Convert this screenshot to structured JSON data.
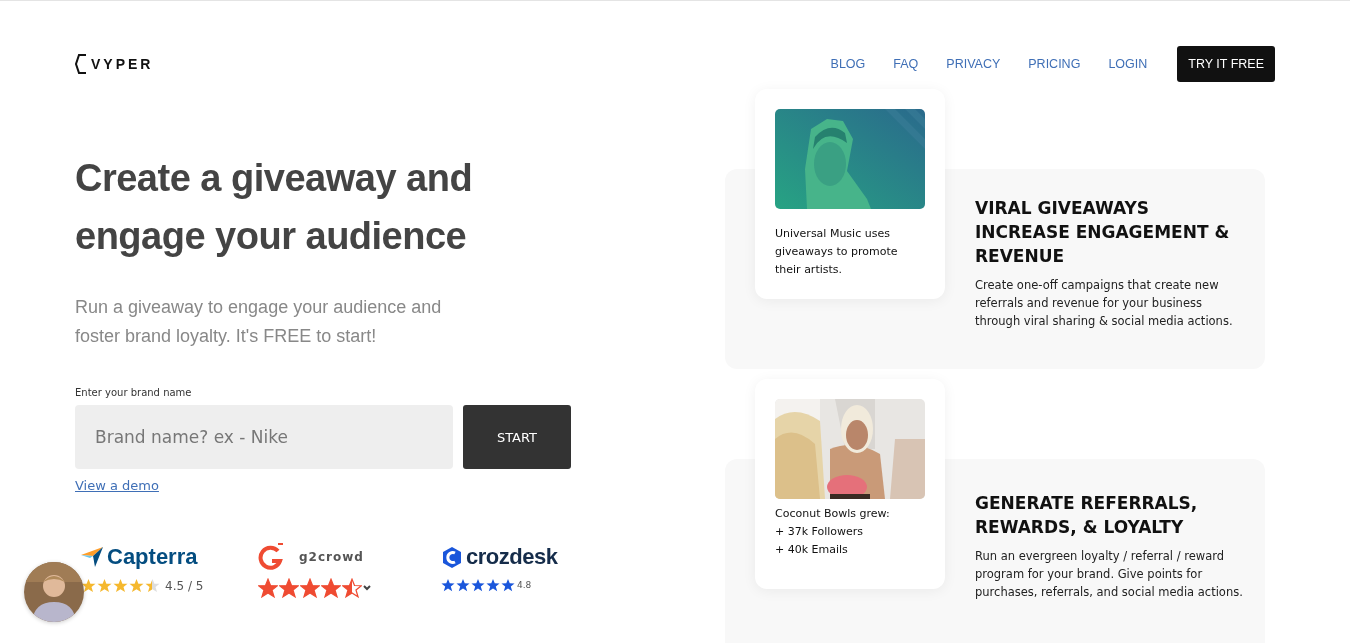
{
  "logo": {
    "text": "VYPER"
  },
  "nav": [
    {
      "label": "BLOG",
      "kind": "link"
    },
    {
      "label": "FAQ",
      "kind": "link"
    },
    {
      "label": "PRIVACY",
      "kind": "link"
    },
    {
      "label": "PRICING",
      "kind": "link"
    },
    {
      "label": "LOGIN",
      "kind": "link"
    },
    {
      "label": "TRY IT FREE",
      "kind": "button"
    }
  ],
  "hero": {
    "title": "Create a giveaway and engage your audience",
    "subtitle": "Run a giveaway to engage your audience and foster brand loyalty. It's FREE to start!",
    "field_label": "Enter your brand name",
    "placeholder": "Brand name? ex - Nike",
    "button": "START",
    "demo_link": "View a demo"
  },
  "reviews": [
    {
      "kind": "capterra",
      "name": "Capterra",
      "stars": 4.5,
      "reading": "4.5 / 5",
      "color": "#f5b82e"
    },
    {
      "kind": "g2",
      "name": "g2crowd",
      "stars": 4.5,
      "color": "#ef4b32"
    },
    {
      "kind": "crozdesk",
      "name": "crozdesk",
      "stars": 5,
      "reading": "4.8",
      "color": "#1a56db"
    }
  ],
  "features": [
    {
      "caption": [
        "Universal Music uses giveaways to promote their artists."
      ],
      "title": "VIRAL GIVEAWAYS INCREASE ENGAGEMENT & REVENUE",
      "text": "Create one-off campaigns that create new referrals and revenue for your business through viral sharing & social media actions.",
      "kind": "teal"
    },
    {
      "caption": [
        "Coconut Bowls grew:",
        "+ 37k Followers",
        "+ 40k Emails"
      ],
      "title": "GENERATE REFERRALS, REWARDS, & LOYALTY",
      "text": "Run an evergreen loyalty / referral / reward program for your brand. Give points for purchases, referrals, and social media actions."
    }
  ]
}
